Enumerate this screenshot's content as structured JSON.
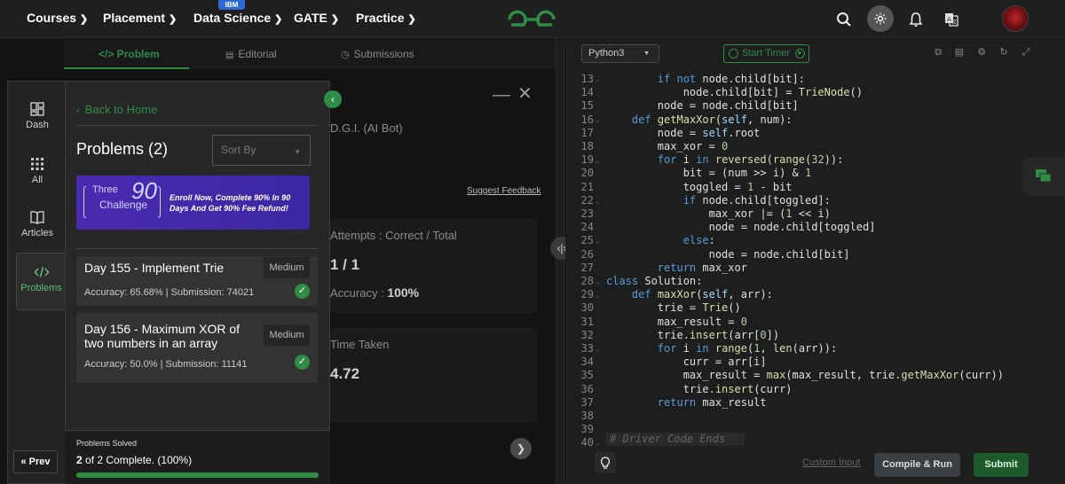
{
  "topnav": {
    "items": [
      {
        "label": "Courses"
      },
      {
        "label": "Placement"
      },
      {
        "label": "Data Science",
        "badge": "IBM"
      },
      {
        "label": "GATE"
      },
      {
        "label": "Practice"
      }
    ],
    "icons": [
      "search-icon",
      "theme-toggle-icon",
      "bell-icon",
      "translate-icon"
    ]
  },
  "tabs": [
    "</> Problem",
    "Editorial",
    "Submissions"
  ],
  "background": {
    "bot_text": "D.G.I. (AI Bot)",
    "suggest_feedback": "Suggest Feedback",
    "attempts_label": "Attempts : Correct / Total",
    "attempts_value": "1 / 1",
    "accuracy_label": "Accuracy :",
    "accuracy_value": "100%",
    "time_taken_label": "Time Taken",
    "time_taken_value": "4.72"
  },
  "sidebar": {
    "items": [
      {
        "label": "Dash",
        "icon": "dashboard-icon"
      },
      {
        "label": "All",
        "icon": "grid-icon"
      },
      {
        "label": "Articles",
        "icon": "book-icon"
      },
      {
        "label": "Problems",
        "icon": "code-icon",
        "active": true
      }
    ],
    "prev_label": "Prev"
  },
  "panel": {
    "back_label": "Back to Home",
    "title": "Problems (2)",
    "sort_placeholder": "Sort By",
    "banner": {
      "three": "Three",
      "ninety": "90",
      "challenge": "Challenge",
      "text": "Enroll Now, Complete 90% In 90 Days And Get 90% Fee Refund!"
    },
    "problems": [
      {
        "title": "Day 155 - Implement Trie",
        "difficulty": "Medium",
        "stats": "Accuracy: 65.68% | Submission: 74021"
      },
      {
        "title": "Day 156 - Maximum XOR of two numbers in an array",
        "difficulty": "Medium",
        "stats": "Accuracy: 50.0% | Submission: 11141"
      }
    ],
    "solved_label": "Problems Solved",
    "solved_count": "2",
    "solved_text": " of 2 Complete. (100%)",
    "progress": 1.0
  },
  "editor": {
    "language": "Python3",
    "timer_label": "Start Timer",
    "custom_input": "Custom Input",
    "compile_run": "Compile & Run",
    "submit": "Submit",
    "footer_comment": "Driver Code Ends"
  },
  "code_lines": [
    {
      "n": "13",
      "fold": true,
      "html": "        <span class='k'>if not</span> node.child[bit]:"
    },
    {
      "n": "14",
      "fold": false,
      "html": "            node.child[bit] = <span class='fn'>TrieNode</span>()"
    },
    {
      "n": "15",
      "fold": false,
      "html": "        node = node.child[bit]"
    },
    {
      "n": "16",
      "fold": true,
      "html": "    <span class='k'>def</span> <span class='fn'>getMaxXor</span>(<span class='self'>self</span>, num):"
    },
    {
      "n": "17",
      "fold": false,
      "html": "        node = <span class='self'>self</span>.root"
    },
    {
      "n": "18",
      "fold": false,
      "html": "        max_xor = <span class='num'>0</span>"
    },
    {
      "n": "19",
      "fold": true,
      "html": "        <span class='k'>for</span> i <span class='k'>in</span> <span class='fn'>reversed</span>(<span class='fn'>range</span>(<span class='num'>32</span>)):"
    },
    {
      "n": "20",
      "fold": false,
      "html": "            bit = (num >> i) & <span class='num'>1</span>"
    },
    {
      "n": "21",
      "fold": false,
      "html": "            toggled = <span class='num'>1</span> - bit"
    },
    {
      "n": "22",
      "fold": true,
      "html": "            <span class='k'>if</span> node.child[toggled]:"
    },
    {
      "n": "23",
      "fold": false,
      "html": "                max_xor |= (<span class='num'>1</span> << i)"
    },
    {
      "n": "24",
      "fold": false,
      "html": "                node = node.child[toggled]"
    },
    {
      "n": "25",
      "fold": true,
      "html": "            <span class='k'>else</span>:"
    },
    {
      "n": "26",
      "fold": false,
      "html": "                node = node.child[bit]"
    },
    {
      "n": "27",
      "fold": false,
      "html": "        <span class='k'>return</span> max_xor"
    },
    {
      "n": "28",
      "fold": true,
      "html": "<span class='k'>class</span> Solution:"
    },
    {
      "n": "29",
      "fold": true,
      "html": "    <span class='k'>def</span> <span class='fn'>maxXor</span>(<span class='self'>self</span>, arr):"
    },
    {
      "n": "30",
      "fold": false,
      "html": "        trie = <span class='fn'>Trie</span>()"
    },
    {
      "n": "31",
      "fold": false,
      "html": "        max_result = <span class='num'>0</span>"
    },
    {
      "n": "32",
      "fold": false,
      "html": "        trie.<span class='fn'>insert</span>(arr[<span class='num'>0</span>])"
    },
    {
      "n": "33",
      "fold": true,
      "html": "        <span class='k'>for</span> i <span class='k'>in</span> <span class='fn'>range</span>(<span class='num'>1</span>, <span class='fn'>len</span>(arr)):"
    },
    {
      "n": "34",
      "fold": false,
      "html": "            curr = arr[i]"
    },
    {
      "n": "35",
      "fold": false,
      "html": "            max_result = <span class='fn'>max</span>(max_result, trie.<span class='fn'>getMaxXor</span>(curr))"
    },
    {
      "n": "36",
      "fold": false,
      "html": "            trie.<span class='fn'>insert</span>(curr)"
    },
    {
      "n": "37",
      "fold": false,
      "html": "        <span class='k'>return</span> max_result"
    },
    {
      "n": "38",
      "fold": false,
      "html": ""
    },
    {
      "n": "39",
      "fold": false,
      "html": ""
    },
    {
      "n": "40",
      "fold": true,
      "html": ""
    }
  ]
}
